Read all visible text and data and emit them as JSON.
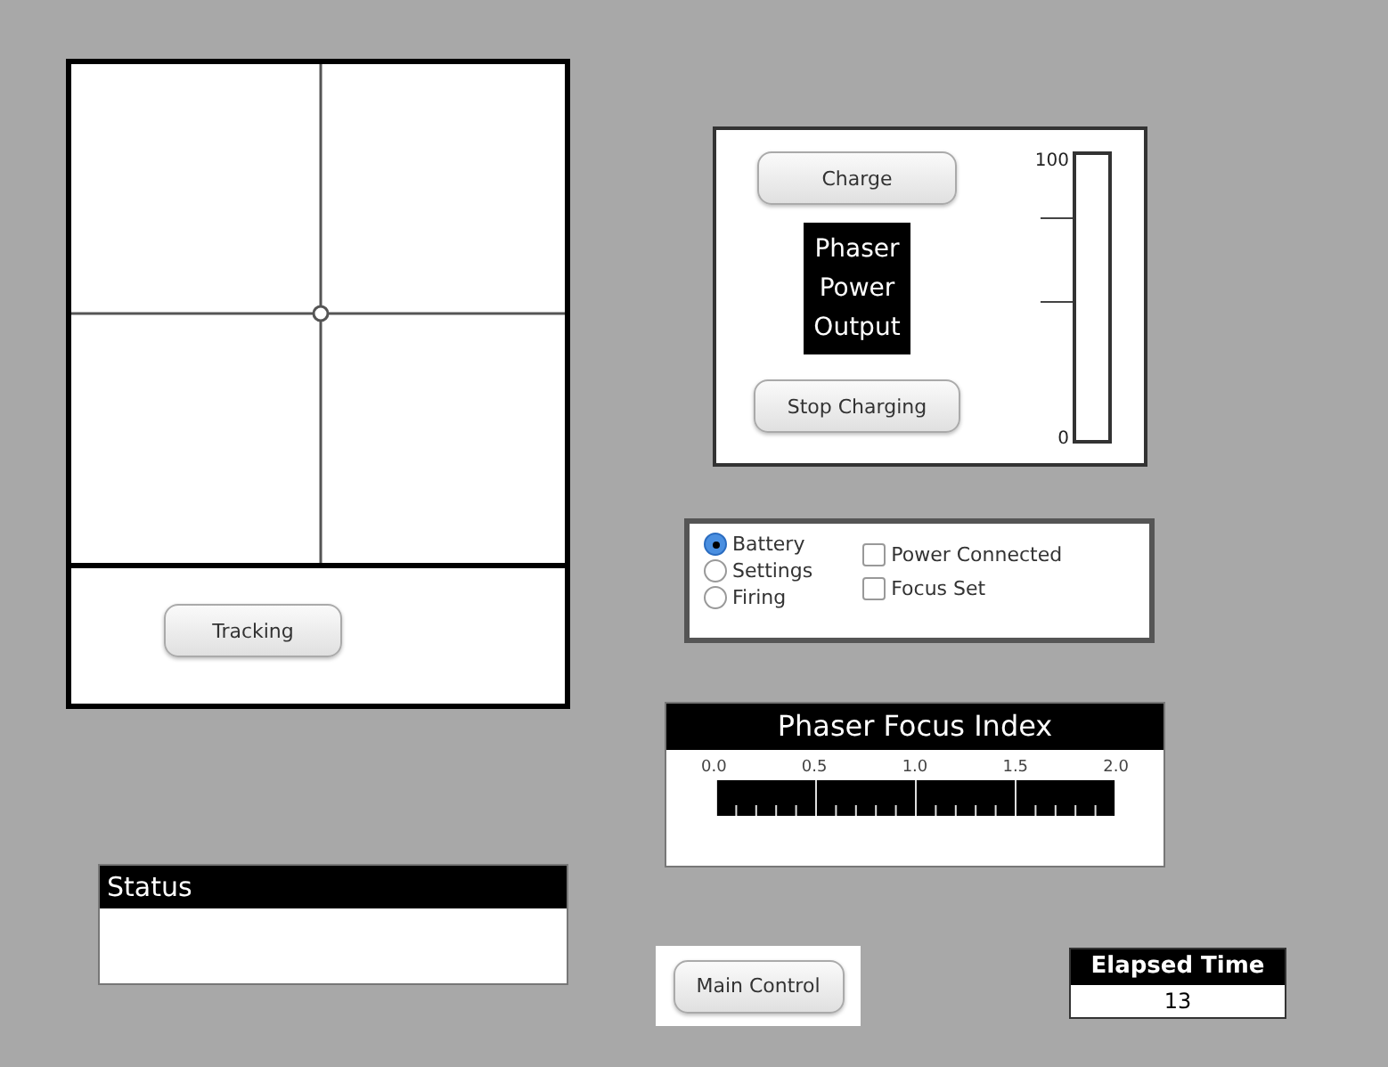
{
  "tracking": {
    "button": "Tracking"
  },
  "power": {
    "charge_button": "Charge",
    "title_lines": [
      "Phaser",
      "Power",
      "Output"
    ],
    "stop_button": "Stop Charging",
    "meter": {
      "max_label": "100",
      "min_label": "0",
      "level": 0
    }
  },
  "modes": [
    {
      "label": "Battery",
      "selected": true
    },
    {
      "label": "Settings",
      "selected": false
    },
    {
      "label": "Firing",
      "selected": false
    }
  ],
  "flags": [
    {
      "label": "Power Connected",
      "checked": false
    },
    {
      "label": "Focus Set",
      "checked": false
    }
  ],
  "focus_index": {
    "title": "Phaser Focus Index",
    "ticks": [
      "0.0",
      "0.5",
      "1.0",
      "1.5",
      "2.0"
    ]
  },
  "status": {
    "title": "Status"
  },
  "main_control": "Main Control",
  "elapsed": {
    "title": "Elapsed Time",
    "value": "13"
  }
}
